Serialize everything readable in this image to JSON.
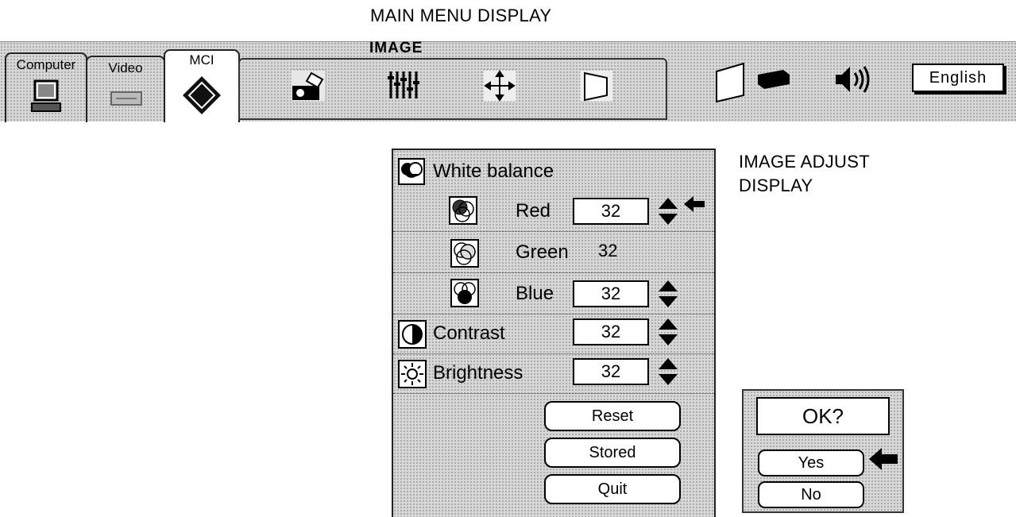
{
  "captions": {
    "main_menu": "MAIN MENU DISPLAY",
    "image_adjust_line1": "IMAGE ADJUST",
    "image_adjust_line2": "DISPLAY"
  },
  "menu": {
    "tabs": [
      {
        "label": "Computer",
        "icon": "computer-icon"
      },
      {
        "label": "Video",
        "icon": "video-deck-icon"
      },
      {
        "label": "MCI",
        "icon": "mci-diamond-icon"
      }
    ],
    "image_label": "IMAGE",
    "image_icons": [
      "projector-adjust-icon",
      "bars-adjust-icon",
      "position-move-icon",
      "keystone-icon"
    ],
    "right_icons": [
      "screen-icon",
      "projector-unit-icon",
      "speaker-icon"
    ],
    "language": "English"
  },
  "adjust": {
    "white_balance": "White balance",
    "rows": [
      {
        "label": "Red",
        "value": "32",
        "icon": "red-circles-icon"
      },
      {
        "label": "Green",
        "value": "32",
        "icon": "green-circles-icon"
      },
      {
        "label": "Blue",
        "value": "32",
        "icon": "blue-circles-icon"
      },
      {
        "label": "Contrast",
        "value": "32",
        "icon": "contrast-icon"
      },
      {
        "label": "Brightness",
        "value": "32",
        "icon": "sun-icon"
      }
    ],
    "buttons": {
      "reset": "Reset",
      "stored": "Stored",
      "quit": "Quit"
    }
  },
  "confirm": {
    "title": "OK?",
    "yes": "Yes",
    "no": "No"
  }
}
